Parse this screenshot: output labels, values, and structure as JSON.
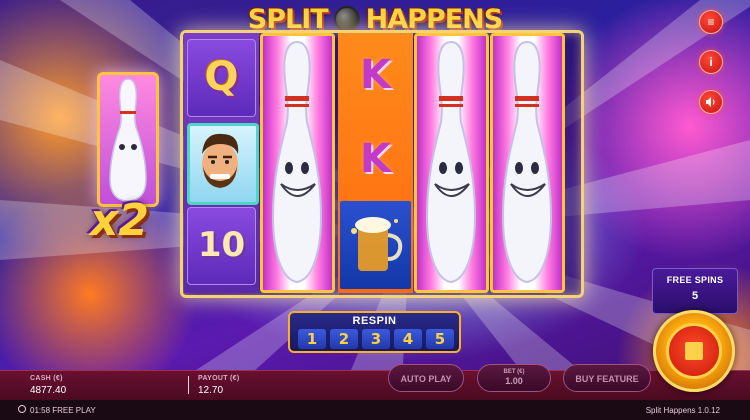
{
  "game": {
    "title_left": "SPLIT",
    "title_right": "HAPPENS",
    "name": "Split Happens",
    "version": "1.0.12"
  },
  "reels": {
    "reel1": [
      "Q",
      "face-symbol",
      "10"
    ],
    "reel2": "bowling-pin-expanded",
    "reel3": [
      "K",
      "K",
      "beer-symbol"
    ],
    "reel4": "bowling-pin-expanded",
    "reel5": "bowling-pin-expanded"
  },
  "side_feature": {
    "multiplier": "x2"
  },
  "respin": {
    "label": "RESPIN",
    "numbers": [
      "1",
      "2",
      "3",
      "4",
      "5"
    ]
  },
  "free_spins": {
    "label": "FREE SPINS",
    "count": "5"
  },
  "hud": {
    "cash_label": "CASH (€)",
    "cash_value": "4877.40",
    "payout_label": "PAYOUT (€)",
    "payout_value": "12.70",
    "auto_play_label": "AUTO PLAY",
    "bet_label": "BET (€)",
    "bet_value": "1.00",
    "buy_feature_label": "BUY FEATURE"
  },
  "status": {
    "time_mode": "01:58 FREE PLAY"
  },
  "icons": {
    "menu": "menu-icon",
    "info": "info-icon",
    "sound": "sound-icon"
  },
  "colors": {
    "accent_gold": "#ffd23a",
    "button_red": "#c4100a",
    "bar_maroon": "#4a0a20"
  }
}
